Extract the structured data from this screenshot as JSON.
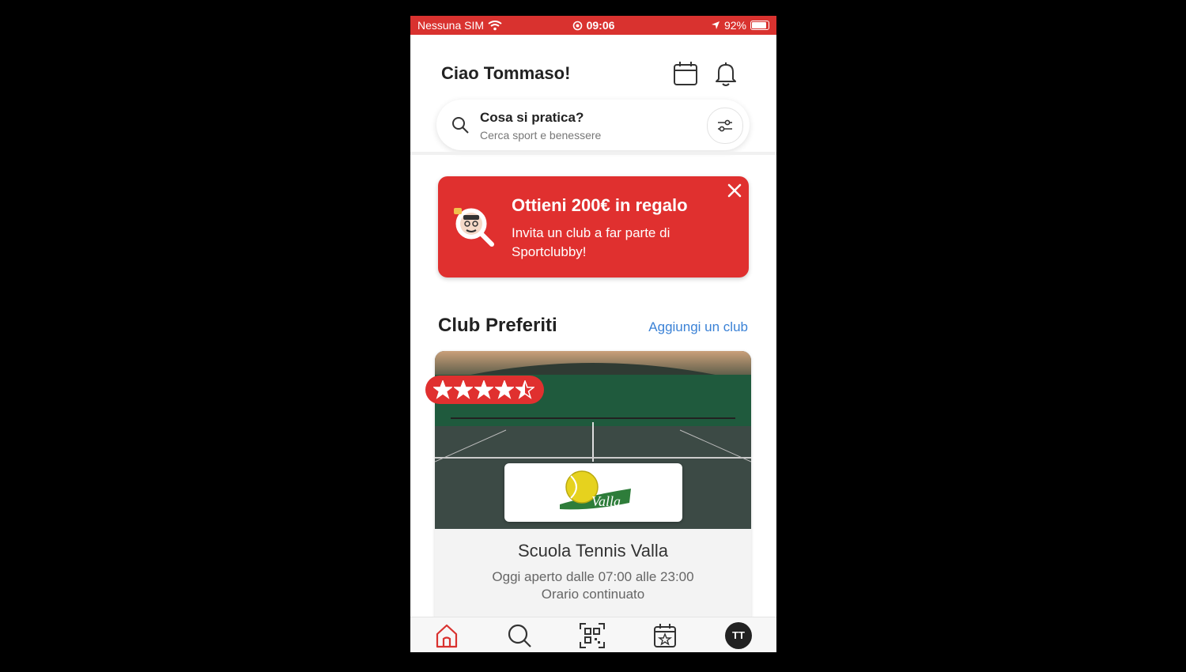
{
  "status_bar": {
    "carrier": "Nessuna SIM",
    "time": "09:06",
    "battery": "92%",
    "battery_level": 0.92
  },
  "header": {
    "greeting": "Ciao Tommaso!",
    "search_title": "Cosa si pratica?",
    "search_subtitle": "Cerca sport e benessere"
  },
  "banner": {
    "title": "Ottieni 200€ in regalo",
    "text": "Invita un club a far parte di Sportclubby!"
  },
  "favorites": {
    "title": "Club Preferiti",
    "add_link": "Aggiungi un club",
    "club": {
      "name": "Scuola Tennis Valla",
      "hours": "Oggi aperto dalle 07:00 alle 23:00",
      "note": "Orario continuato",
      "rating": 4.5,
      "logo_text": "Valla"
    }
  },
  "tabbar": {
    "avatar_initials": "TT"
  },
  "colors": {
    "brand_red": "#e0302f",
    "link_blue": "#3b82d6"
  }
}
